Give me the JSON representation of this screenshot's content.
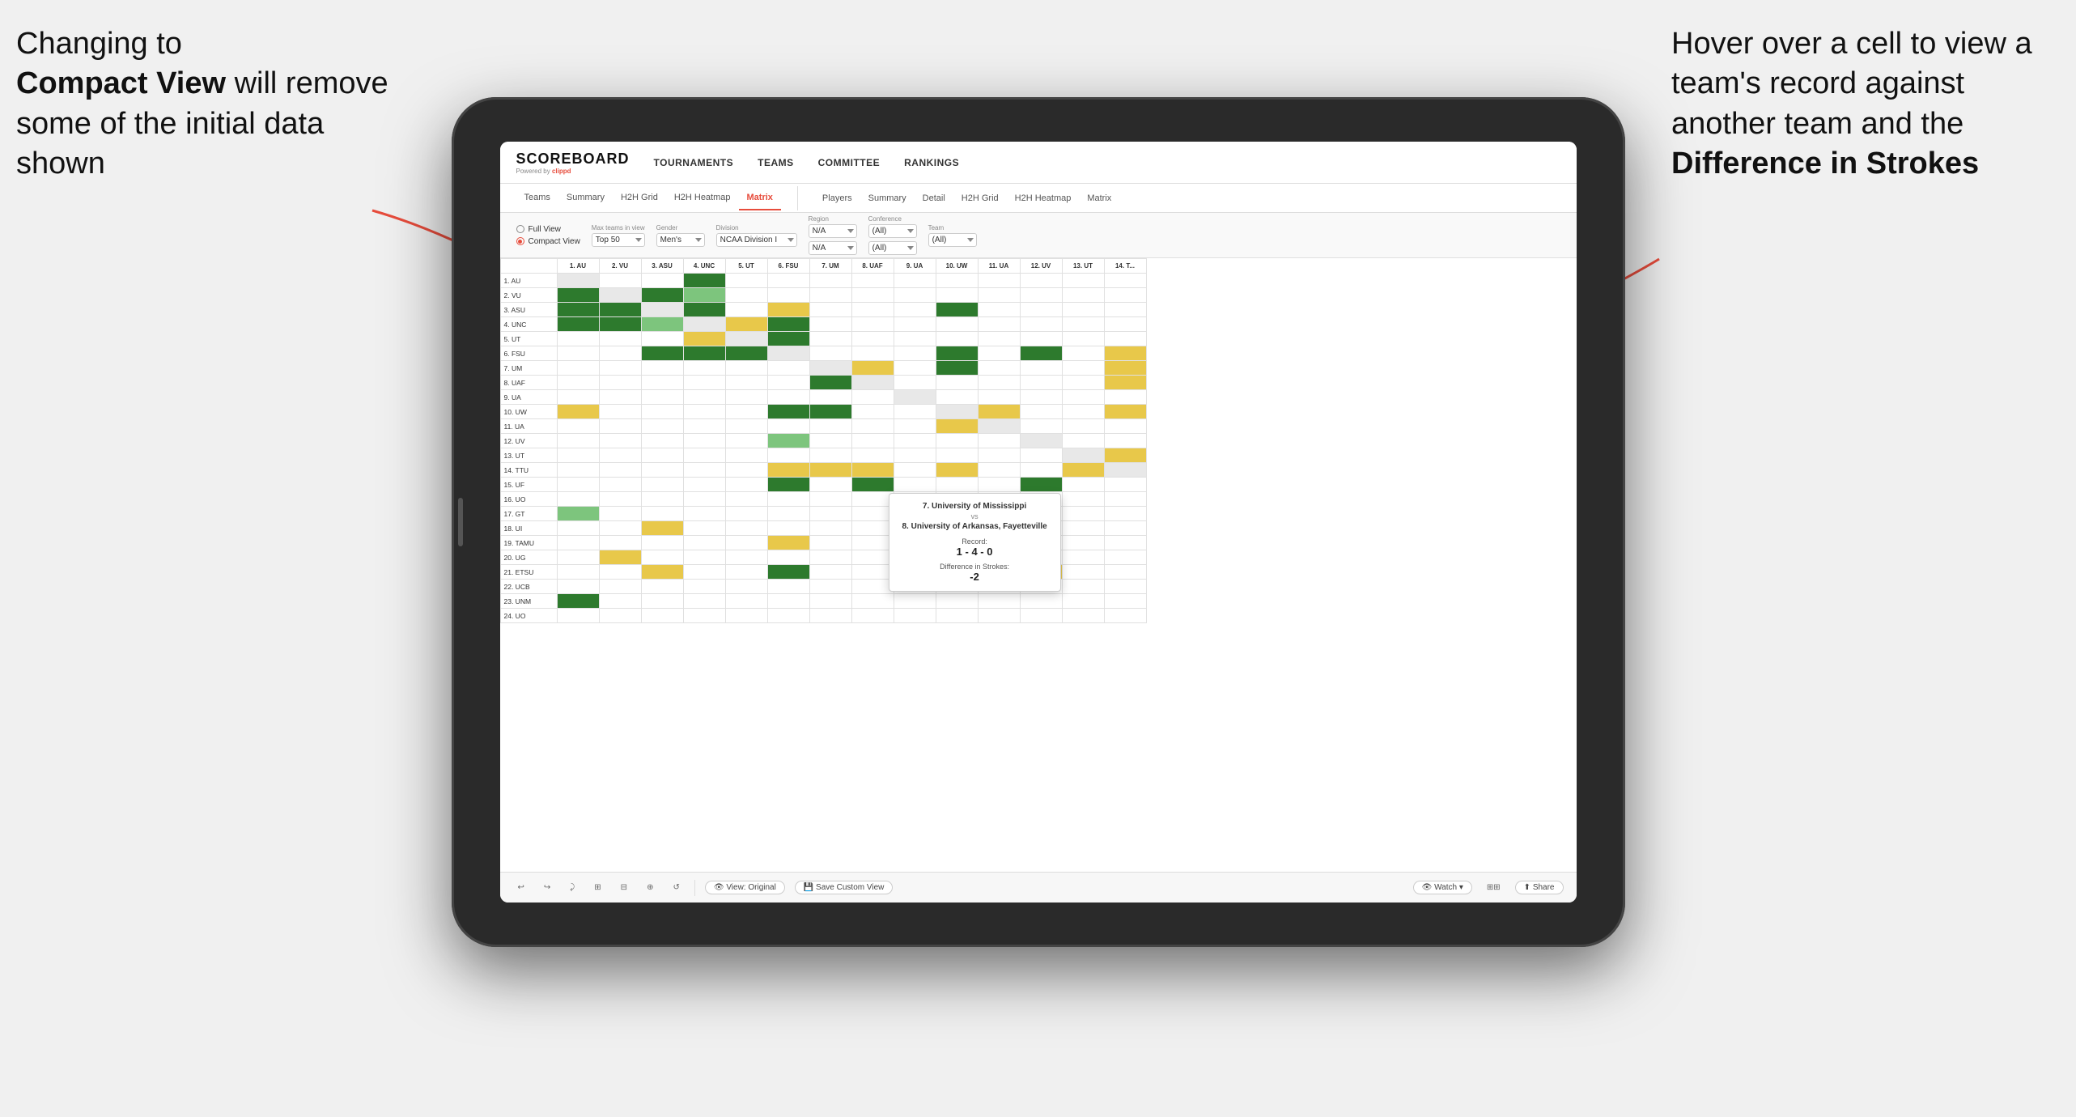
{
  "annotations": {
    "left_text_line1": "Changing to",
    "left_text_bold": "Compact View",
    "left_text_rest": " will remove some of the initial data shown",
    "right_text_line1": "Hover over a cell to view a team's record against another team and the ",
    "right_text_bold": "Difference in Strokes"
  },
  "app": {
    "logo": "SCOREBOARD",
    "logo_sub": "Powered by clippd",
    "nav": [
      "TOURNAMENTS",
      "TEAMS",
      "COMMITTEE",
      "RANKINGS"
    ]
  },
  "sub_tabs_left": [
    "Teams",
    "Summary",
    "H2H Grid",
    "H2H Heatmap",
    "Matrix"
  ],
  "sub_tabs_right": [
    "Players",
    "Summary",
    "Detail",
    "H2H Grid",
    "H2H Heatmap",
    "Matrix"
  ],
  "active_tab": "Matrix",
  "filters": {
    "view_full": "Full View",
    "view_compact": "Compact View",
    "compact_selected": true,
    "max_teams_label": "Max teams in view",
    "max_teams_value": "Top 50",
    "gender_label": "Gender",
    "gender_value": "Men's",
    "division_label": "Division",
    "division_value": "NCAA Division I",
    "region_label": "Region",
    "region_value": "N/A",
    "region_value2": "N/A",
    "conference_label": "Conference",
    "conference_value": "(All)",
    "conference_value2": "(All)",
    "team_label": "Team",
    "team_value": "(All)"
  },
  "col_headers": [
    "1. AU",
    "2. VU",
    "3. ASU",
    "4. UNC",
    "5. UT",
    "6. FSU",
    "7. UM",
    "8. UAF",
    "9. UA",
    "10. UW",
    "11. UA",
    "12. UV",
    "13. UT",
    "14. T..."
  ],
  "row_headers": [
    "1. AU",
    "2. VU",
    "3. ASU",
    "4. UNC",
    "5. UT",
    "6. FSU",
    "7. UM",
    "8. UAF",
    "9. UA",
    "10. UW",
    "11. UA",
    "12. UV",
    "13. UT",
    "14. TTU",
    "15. UF",
    "16. UO",
    "17. GT",
    "18. UI",
    "19. TAMU",
    "20. UG",
    "21. ETSU",
    "22. UCB",
    "23. UNM",
    "24. UO"
  ],
  "tooltip": {
    "team1": "7. University of Mississippi",
    "vs": "vs",
    "team2": "8. University of Arkansas, Fayetteville",
    "record_label": "Record:",
    "record_value": "1 - 4 - 0",
    "strokes_label": "Difference in Strokes:",
    "strokes_value": "-2"
  },
  "toolbar": {
    "undo": "↩",
    "redo": "↪",
    "icon1": "⤸",
    "icon2": "⊞",
    "icon3": "⊟",
    "icon4": "⊕",
    "icon5": "↺",
    "view_original": "View: Original",
    "save_custom": "Save Custom View",
    "watch": "Watch ▾",
    "share": "Share"
  }
}
